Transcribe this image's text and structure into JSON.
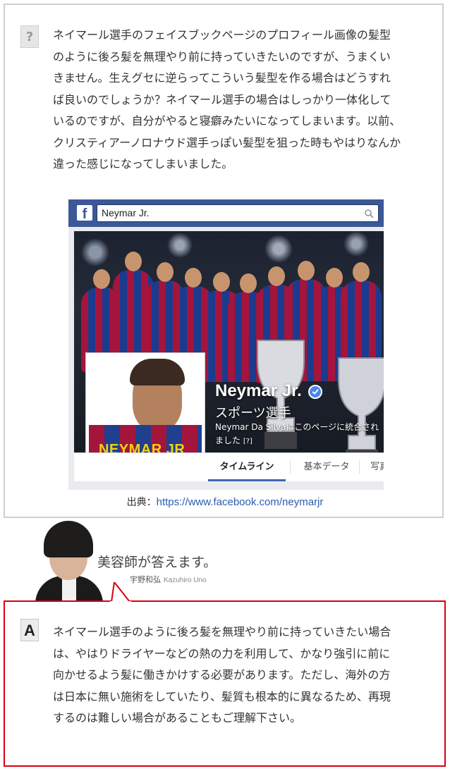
{
  "question": {
    "icon": "?",
    "text": "ネイマール選手のフェイスブックページのプロフィール画像の髪型のように後ろ髪を無理やり前に持っていきたいのですが、うまくいきません。生えグセに逆らってこういう髪型を作る場合はどうすれば良いのでしょうか？ネイマール選手の場合はしっかり一体化しているのですが、自分がやると寝癖みたいになってしまいます。以前、クリスティアーノロナウド選手っぽい髪型を狙った時もやはりなんか違った感じになってしまいました。"
  },
  "facebook": {
    "logo": "f",
    "search_value": "Neymar Jr.",
    "profile_jersey_text": "NEYMAR JR",
    "page_name": "Neymar Jr.",
    "category": "スポーツ選手",
    "merge_notice": "Neymar Da Silvaはこのページに統合されました",
    "merge_help": "[?]",
    "tabs": [
      "タイムライン",
      "基本データ",
      "写真"
    ]
  },
  "source": {
    "label": "出典：",
    "url": "https://www.facebook.com/neymarjr"
  },
  "answerer": {
    "title": "美容師が答えます。",
    "name": "宇野和弘",
    "name_roman": "Kazuhiro Uno"
  },
  "answer": {
    "icon": "A",
    "text": "ネイマール選手のように後ろ髪を無理やり前に持っていきたい場合は、やはりドライヤーなどの熱の力を利用して、かなり強引に前に向かせるよう髪に働きかけする必要があります。ただし、海外の方は日本に無い施術をしていたり、髪質も根本的に異なるため、再現するのは難しい場合があることもご理解下さい。"
  },
  "colors": {
    "facebook_blue": "#3b5998",
    "answer_border": "#d7000f",
    "link": "#2a5db0"
  }
}
